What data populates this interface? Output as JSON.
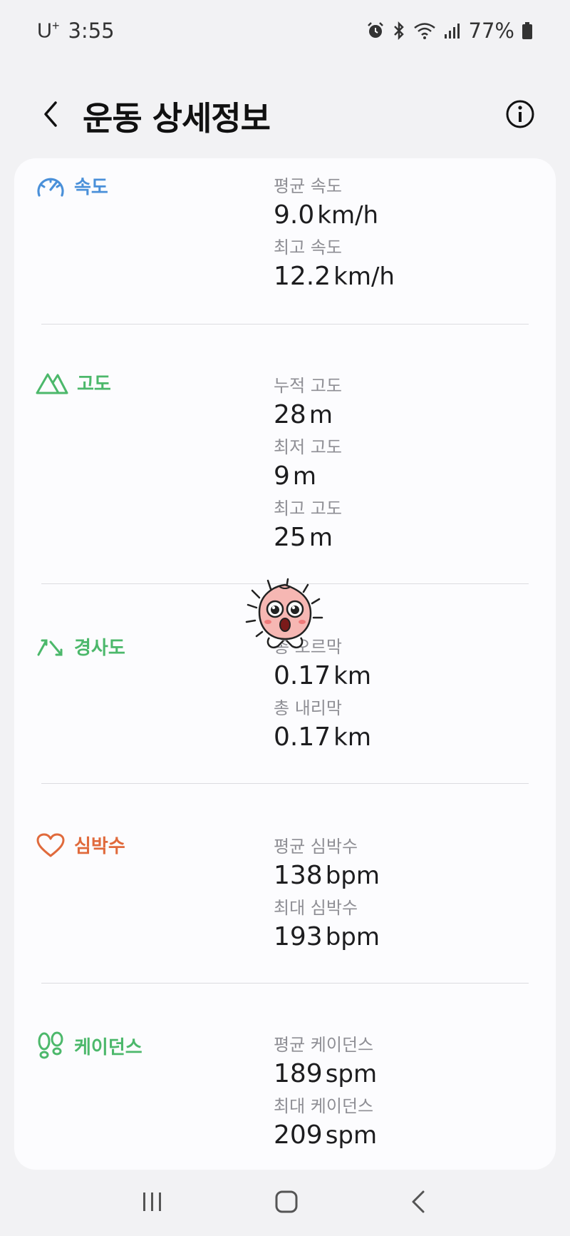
{
  "status_bar": {
    "carrier": "U",
    "carrier_sup": "+",
    "time": "3:55",
    "battery": "77%"
  },
  "header": {
    "title": "운동 상세정보"
  },
  "colors": {
    "speed": "#4a90d9",
    "altitude": "#4cb86b",
    "slope": "#4cb86b",
    "heart": "#e06a3c",
    "cadence": "#4cb86b"
  },
  "sections": {
    "speed": {
      "title": "속도",
      "icon": "speedometer-icon",
      "m1_label": "평균 속도",
      "m1_value": "9.0",
      "m1_unit": "km/h",
      "m2_label": "최고 속도",
      "m2_value": "12.2",
      "m2_unit": "km/h"
    },
    "altitude": {
      "title": "고도",
      "icon": "mountain-icon",
      "m1_label": "누적 고도",
      "m1_value": "28",
      "m1_unit": "m",
      "m2_label": "최저 고도",
      "m2_value": "9",
      "m2_unit": "m",
      "m3_label": "최고 고도",
      "m3_value": "25",
      "m3_unit": "m"
    },
    "slope": {
      "title": "경사도",
      "icon": "slope-arrows-icon",
      "m1_label": "총 오르막",
      "m1_value": "0.17",
      "m1_unit": "km",
      "m2_label": "총 내리막",
      "m2_value": "0.17",
      "m2_unit": "km"
    },
    "heart": {
      "title": "심박수",
      "icon": "heart-icon",
      "m1_label": "평균 심박수",
      "m1_value": "138",
      "m1_unit": "bpm",
      "m2_label": "최대 심박수",
      "m2_value": "193",
      "m2_unit": "bpm"
    },
    "cadence": {
      "title": "케이던스",
      "icon": "footprints-icon",
      "m1_label": "평균 케이던스",
      "m1_value": "189",
      "m1_unit": "spm",
      "m2_label": "최대 케이던스",
      "m2_value": "209",
      "m2_unit": "spm"
    }
  }
}
